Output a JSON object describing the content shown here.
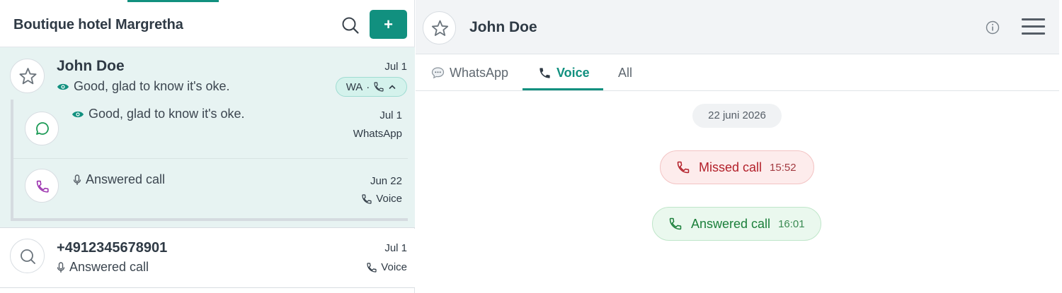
{
  "colors": {
    "accent": "#11907f",
    "selected_bg": "#e7f3f2",
    "missed_red": "#b3202a",
    "answered_green": "#1b7f3a"
  },
  "left_panel": {
    "title": "Boutique hotel Margretha",
    "search_icon": "search-icon",
    "add_button_label": "+",
    "conversations": [
      {
        "name": "John Doe",
        "date": "Jul 1",
        "last_message": "Good, glad to know it's oke.",
        "status_icon": "eye-icon",
        "channel_pill": "WA",
        "pill_separator": "·",
        "sub_items": [
          {
            "message": "Good, glad to know it's oke.",
            "date": "Jul 1",
            "channel": "WhatsApp",
            "icon": "chat-bubble-icon"
          },
          {
            "message": "Answered call",
            "date": "Jun 22",
            "channel": "Voice",
            "icon": "phone-icon"
          }
        ]
      },
      {
        "name": "+4912345678901",
        "date": "Jul 1",
        "last_message": "Answered call",
        "channel": "Voice"
      }
    ]
  },
  "right_panel": {
    "contact_name": "John Doe",
    "tabs": [
      {
        "label": "WhatsApp",
        "icon": "speech-bubble-icon",
        "active": false
      },
      {
        "label": "Voice",
        "icon": "phone-icon",
        "active": true
      },
      {
        "label": "All",
        "active": false
      }
    ],
    "date_separator": "22 juni 2026",
    "calls": [
      {
        "label": "Missed call",
        "time": "15:52",
        "status": "missed"
      },
      {
        "label": "Answered call",
        "time": "16:01",
        "status": "answered"
      }
    ]
  }
}
